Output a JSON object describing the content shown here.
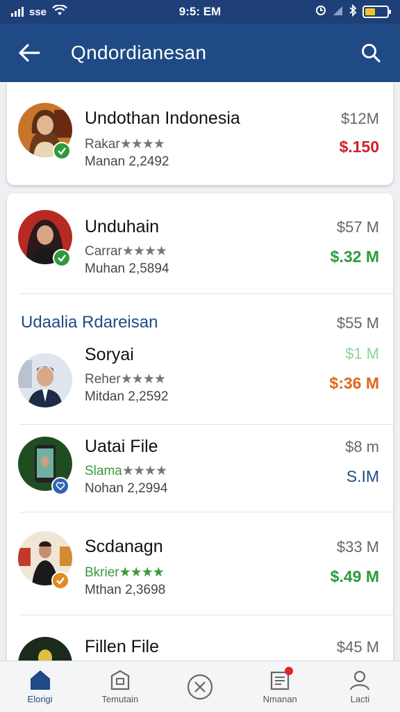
{
  "status_bar": {
    "carrier": "sse",
    "time": "9:5: EM"
  },
  "header": {
    "title": "Qndordianesan"
  },
  "colors": {
    "primary": "#1f4a86",
    "red": "#d0202a",
    "green": "#2e9a3c",
    "orange": "#e0661f",
    "navy": "#1f4a86"
  },
  "top_card": {
    "name": "Undothan Indonesia",
    "sub1": "Rakar",
    "stars": "★★★★",
    "sub2": "Manan 2,2492",
    "amount_top": "$12M",
    "amount_bottom": "$.150"
  },
  "list": {
    "section_header": "Udaalia Rdareisan",
    "items": [
      {
        "name": "Unduhain",
        "sub1": "Carrar",
        "stars": "★★★★",
        "sub2": "Muhan 2,5894",
        "amount_top": "$57 M",
        "amount_bottom": "$.32 M"
      },
      {
        "name": "Soryai",
        "sub1": "Reher",
        "stars": "★★★★",
        "sub2": "Mitdan 2,2592",
        "amount_top": "$1 M",
        "amount_bottom": "$:36 M"
      },
      {
        "name": "Uatai File",
        "sub1": "Slama",
        "stars": "★★★★",
        "sub2": "Nohan 2,2994",
        "amount_top": "$8 m",
        "amount_bottom": "S.IM"
      },
      {
        "name": "Scdanagn",
        "sub1": "Bkrier",
        "stars": "★★★★",
        "sub2": "Mthan 2,3698",
        "amount_top": "$33 M",
        "amount_bottom": "$.49 M"
      },
      {
        "name": "Fillen File",
        "sub1": "",
        "stars": "",
        "sub2": "",
        "amount_top": "$45 M",
        "amount_bottom": ""
      }
    ],
    "section_amount": "$55 M"
  },
  "bottom_nav": {
    "items": [
      {
        "label": "Elorigi",
        "icon": "home-icon"
      },
      {
        "label": "Temutain",
        "icon": "box-icon"
      },
      {
        "label": "",
        "icon": "close-circle-icon"
      },
      {
        "label": "Nmanan",
        "icon": "document-icon"
      },
      {
        "label": "Lacti",
        "icon": "user-icon"
      }
    ]
  }
}
